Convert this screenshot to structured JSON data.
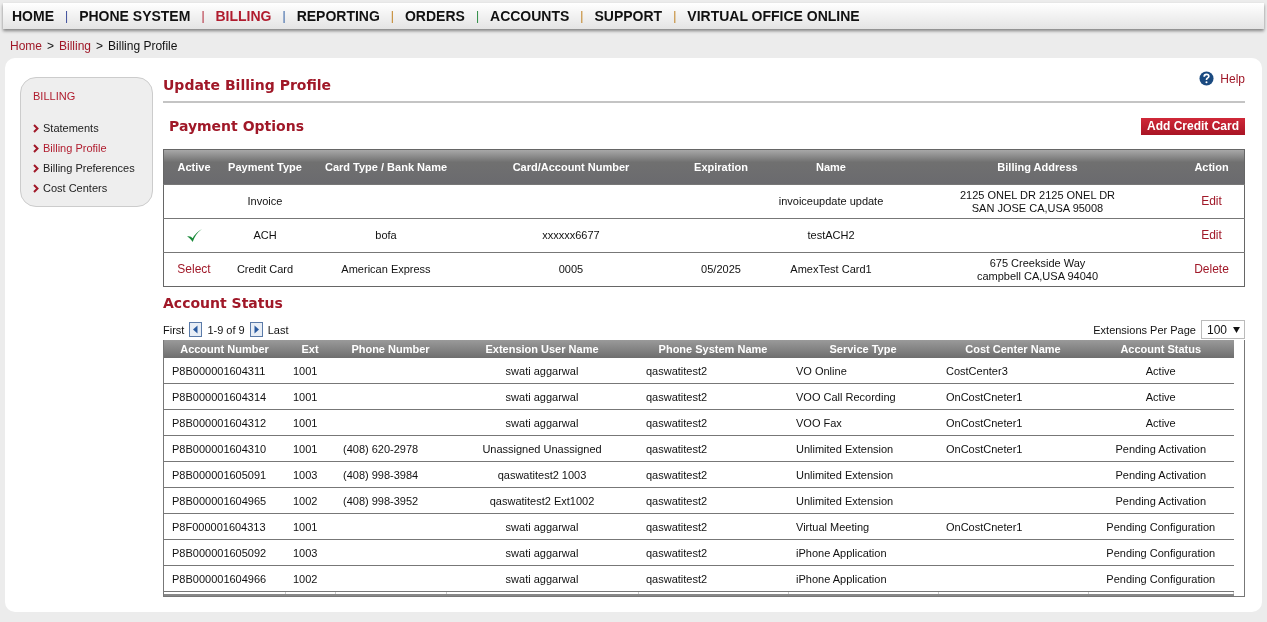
{
  "nav": {
    "items": [
      {
        "label": "HOME",
        "selected": false,
        "separator": "|"
      },
      {
        "label": "PHONE SYSTEM",
        "selected": false,
        "separator": "|"
      },
      {
        "label": "BILLING",
        "selected": true,
        "separator": "|"
      },
      {
        "label": "REPORTING",
        "selected": false,
        "separator": "|"
      },
      {
        "label": "ORDERS",
        "selected": false,
        "separator": "|"
      },
      {
        "label": "ACCOUNTS",
        "selected": false,
        "separator": "|"
      },
      {
        "label": "SUPPORT",
        "selected": false,
        "separator": "|"
      },
      {
        "label": "VIRTUAL OFFICE ONLINE",
        "selected": false
      }
    ]
  },
  "breadcrumb": {
    "links": [
      "Home",
      "Billing"
    ],
    "separators": [
      ">",
      ">"
    ],
    "current": "Billing Profile"
  },
  "sidebar": {
    "title": "BILLING",
    "items": [
      {
        "label": "Statements",
        "selected": false
      },
      {
        "label": "Billing Profile",
        "selected": true
      },
      {
        "label": "Billing Preferences",
        "selected": false
      },
      {
        "label": "Cost Centers",
        "selected": false
      }
    ]
  },
  "page_title": "Update Billing Profile",
  "help": "Help",
  "payment_options": {
    "title": "Payment Options",
    "add_button": "Add Credit Card",
    "columns": [
      "Active",
      "Payment Type",
      "Card Type / Bank Name",
      "Card/Account Number",
      "Expiration",
      "Name",
      "Billing Address",
      "Action"
    ],
    "rows": [
      {
        "kind": "none",
        "payment_type": "Invoice",
        "card_type": "",
        "number": "",
        "expiration": "",
        "name": "invoiceupdate update",
        "address": [
          "2125 ONEL DR 2125 ONEL DR",
          "SAN JOSE CA,USA 95008"
        ],
        "action": "Edit"
      },
      {
        "kind": "active",
        "payment_type": "ACH",
        "card_type": "bofa",
        "number": "xxxxxx6677",
        "expiration": "",
        "name": "testACH2",
        "address": [],
        "action": "Edit"
      },
      {
        "kind": "select",
        "select_label": "Select",
        "payment_type": "Credit Card",
        "card_type": "American Express",
        "number": "0005",
        "expiration": "05/2025",
        "name": "AmexTest Card1",
        "address": [
          "675 Creekside Way",
          "campbell CA,USA 94040"
        ],
        "action": "Delete"
      }
    ]
  },
  "account_status": {
    "title": "Account Status",
    "pager": {
      "first": "First",
      "range": "1-9 of 9",
      "last": "Last"
    },
    "per_page": {
      "label": "Extensions Per Page",
      "value": "100"
    },
    "columns": [
      "Account Number",
      "Ext",
      "Phone Number",
      "Extension User Name",
      "Phone System Name",
      "Service Type",
      "Cost Center Name",
      "Account Status"
    ],
    "rows": [
      [
        "P8B000001604311",
        "1001",
        "",
        "swati aggarwal",
        "qaswatitest2",
        "VO Online",
        "CostCenter3",
        "Active"
      ],
      [
        "P8B000001604314",
        "1001",
        "",
        "swati aggarwal",
        "qaswatitest2",
        "VOO Call Recording",
        "OnCostCneter1",
        "Active"
      ],
      [
        "P8B000001604312",
        "1001",
        "",
        "swati aggarwal",
        "qaswatitest2",
        "VOO Fax",
        "OnCostCneter1",
        "Active"
      ],
      [
        "P8B000001604310",
        "1001",
        "(408) 620-2978",
        "Unassigned Unassigned",
        "qaswatitest2",
        "Unlimited Extension",
        "OnCostCneter1",
        "Pending Activation"
      ],
      [
        "P8B000001605091",
        "1003",
        "(408) 998-3984",
        "qaswatitest2 1003",
        "qaswatitest2",
        "Unlimited Extension",
        "",
        "Pending Activation"
      ],
      [
        "P8B000001604965",
        "1002",
        "(408) 998-3952",
        "qaswatitest2 Ext1002",
        "qaswatitest2",
        "Unlimited Extension",
        "",
        "Pending Activation"
      ],
      [
        "P8F000001604313",
        "1001",
        "",
        "swati aggarwal",
        "qaswatitest2",
        "Virtual Meeting",
        "OnCostCneter1",
        "Pending Configuration"
      ],
      [
        "P8B000001605092",
        "1003",
        "",
        "swati aggarwal",
        "qaswatitest2",
        "iPhone Application",
        "",
        "Pending Configuration"
      ],
      [
        "P8B000001604966",
        "1002",
        "",
        "swati aggarwal",
        "qaswatitest2",
        "iPhone Application",
        "",
        "Pending Configuration"
      ]
    ]
  }
}
